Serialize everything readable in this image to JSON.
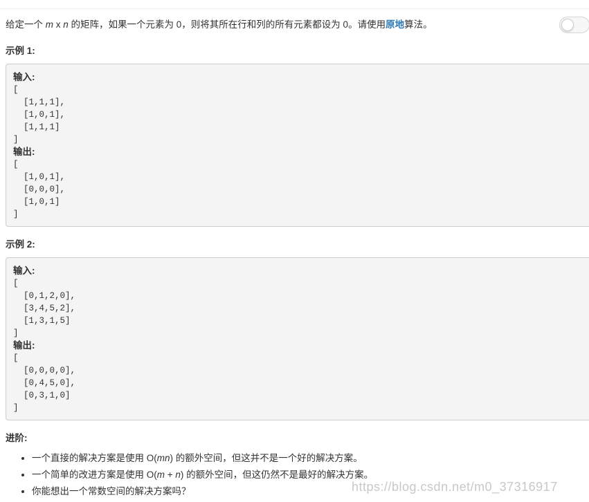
{
  "problem": {
    "p1": "给定一个 ",
    "m": "m",
    "x": " x ",
    "n": "n",
    "p2": " 的矩阵，如果一个元素为 0，则将其所在行和列的所有元素都设为 0。请使用",
    "bold": "原地",
    "p3": "算法。"
  },
  "toggle": {
    "state": "off"
  },
  "example1": {
    "title": "示例 1:",
    "lines": [
      "输入:",
      "[",
      "  [1,1,1],",
      "  [1,0,1],",
      "  [1,1,1]",
      "]",
      "输出:",
      "[",
      "  [1,0,1],",
      "  [0,0,0],",
      "  [1,0,1]",
      "]"
    ]
  },
  "example2": {
    "title": "示例 2:",
    "lines": [
      "输入:",
      "[",
      "  [0,1,2,0],",
      "  [3,4,5,2],",
      "  [1,3,1,5]",
      "]",
      "输出:",
      "[",
      "  [0,0,0,0],",
      "  [0,4,5,0],",
      "  [0,3,1,0]",
      "]"
    ]
  },
  "advanced": {
    "title": "进阶:",
    "b1": {
      "pre": "一个直接的解决方案是使用  O(",
      "var": "mn",
      "post": ") 的额外空间，但这并不是一个好的解决方案。"
    },
    "b2": {
      "pre": "一个简单的改进方案是使用 O(",
      "var": "m",
      "mid": " + ",
      "var2": "n",
      "post": ") 的额外空间，但这仍然不是最好的解决方案。"
    },
    "b3": {
      "text": "你能想出一个常数空间的解决方案吗？"
    }
  },
  "watermark": "https://blog.csdn.net/m0_37316917",
  "colors": {
    "link_bold": "#2a7ab8",
    "code_bg": "#f4f4f4",
    "border": "#cccccc"
  }
}
